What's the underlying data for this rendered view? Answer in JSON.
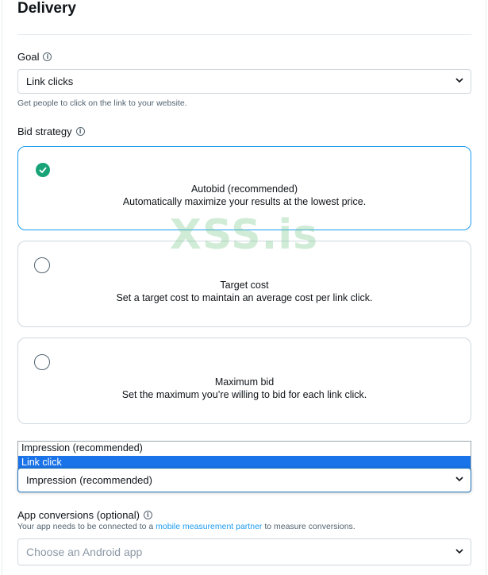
{
  "section_title": "Delivery",
  "goal": {
    "label": "Goal",
    "value": "Link clicks",
    "helper": "Get people to click on the link to your website."
  },
  "bid_strategy": {
    "label": "Bid strategy",
    "options": [
      {
        "title": "Autobid (recommended)",
        "description": "Automatically maximize your results at the lowest price.",
        "selected": true
      },
      {
        "title": "Target cost",
        "description": "Set a target cost to maintain an average cost per link click.",
        "selected": false
      },
      {
        "title": "Maximum bid",
        "description": "Set the maximum you’re willing to bid for each link click.",
        "selected": false
      }
    ]
  },
  "billing": {
    "value": "Impression (recommended)",
    "options": [
      "Impression (recommended)",
      "Link click"
    ],
    "highlighted_option": "Link click"
  },
  "app_conversions": {
    "label": "App conversions (optional)",
    "helper_prefix": "Your app needs to be connected to a ",
    "helper_link": "mobile measurement partner",
    "helper_suffix": " to measure conversions.",
    "placeholder": "Choose an Android app"
  },
  "watermark": "XSS.is",
  "colors": {
    "accent": "#1d9bf0",
    "check": "#17a377",
    "highlight": "#1a73e8"
  },
  "icons": [
    "info-icon",
    "chevron-down-icon",
    "checkmark-icon"
  ]
}
